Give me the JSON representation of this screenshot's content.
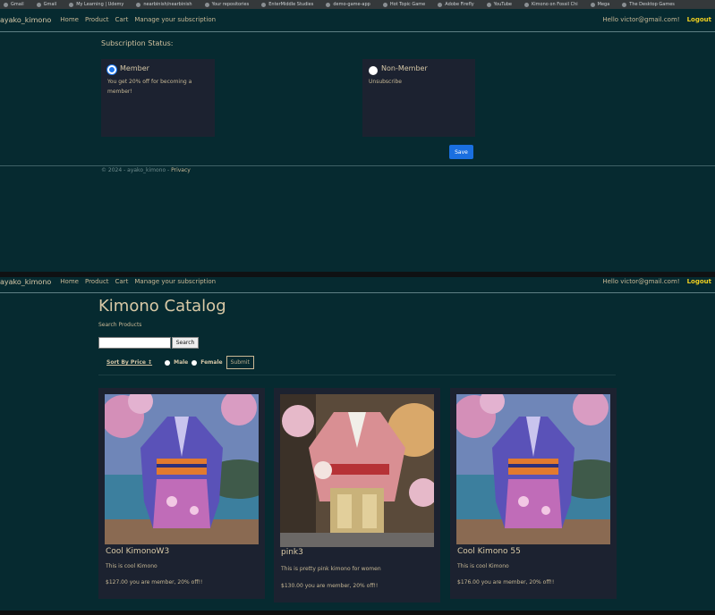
{
  "bookmarks": [
    "Gmail",
    "Gmail",
    "My Learning | Udemy",
    "nearbinish/nearbinish",
    "Your repositories",
    "EnterMiddle Studies",
    "demo-game-app",
    "Hot Topic Game",
    "Adobe Firefly",
    "YouTube",
    "Kimono on Fossil Chi",
    "Mega",
    "The Desktop Games"
  ],
  "colors": {
    "accent": "#1a6fe0",
    "logout": "#f0d020",
    "background": "#062a30",
    "card": "#1c2230"
  },
  "nav": {
    "brand": "ayako_kimono",
    "links": [
      "Home",
      "Product",
      "Cart",
      "Manage your subscription"
    ],
    "hello": "Hello victor@gmail.com!",
    "logout": "Logout"
  },
  "subscription": {
    "title": "Subscription Status:",
    "member": {
      "label": "Member",
      "desc": "You get 20% off for becoming a member!",
      "checked": true
    },
    "non_member": {
      "label": "Non-Member",
      "desc": "Unsubscribe",
      "checked": false
    },
    "save_label": "Save"
  },
  "footer": {
    "copyright": "© 2024 - ayako_kimono - ",
    "privacy": "Privacy"
  },
  "catalog": {
    "title": "Kimono Catalog",
    "search_label": "Search Products",
    "search_button": "Search",
    "sort_label": "Sort By Price ↕",
    "filter_male": "Male",
    "filter_female": "Female",
    "submit": "Submit",
    "products": [
      {
        "name": "Cool KimonoW3",
        "desc": "This is cool Kimono",
        "price": "$127.00 you are member, 20% off!!"
      },
      {
        "name": "pink3",
        "desc": "This is pretty pink kimono for women",
        "price": "$130.00 you are member, 20% off!!"
      },
      {
        "name": "Cool Kimono 55",
        "desc": "This is cool Kimono",
        "price": "$176.00 you are member, 20% off!!"
      }
    ]
  }
}
